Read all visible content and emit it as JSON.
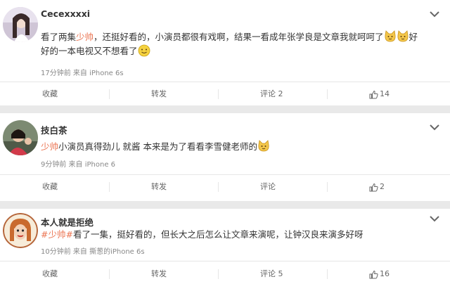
{
  "posts": [
    {
      "username": "Cecexxxxi",
      "body_prefix": "看了两集",
      "body_highlight": "少帅",
      "body_mid": "，还挺好看的，小演员都很有戏啊，结果一看成年张学良是文章我就呵呵了",
      "body_tail_1": "好",
      "body_line2": "好的一本电视又不想看了",
      "meta": "17分钟前 来自 iPhone 6s",
      "actions": {
        "collect": "收藏",
        "repost": "转发",
        "comment": "评论 2",
        "like": "14"
      }
    },
    {
      "username": "技白茶",
      "body_highlight": "少帅",
      "body_rest": "小演员真得劲儿 就酱 本来是为了看看李雪健老师的",
      "meta": "9分钟前 来自 iPhone 6",
      "actions": {
        "collect": "收藏",
        "repost": "转发",
        "comment": "评论",
        "like": "2"
      }
    },
    {
      "username": "本人就是拒绝",
      "body_highlight": "#少帅#",
      "body_rest": "看了一集，挺好看的，但长大之后怎么让文章来演呢，让钟汉良来演多好呀",
      "meta": "10分钟前 来自 撕葱的iPhone 6s",
      "actions": {
        "collect": "收藏",
        "repost": "转发",
        "comment": "评论 5",
        "like": "16"
      }
    }
  ],
  "icons": {
    "chevron": "chevron-down-icon",
    "like": "thumbs-up-icon",
    "emoji": "smile-emoji-icon",
    "cat_emoji": "cat-emoji-icon"
  },
  "colors": {
    "highlight": "#eb7350",
    "divider": "#e9e9e9",
    "meta": "#888888"
  }
}
